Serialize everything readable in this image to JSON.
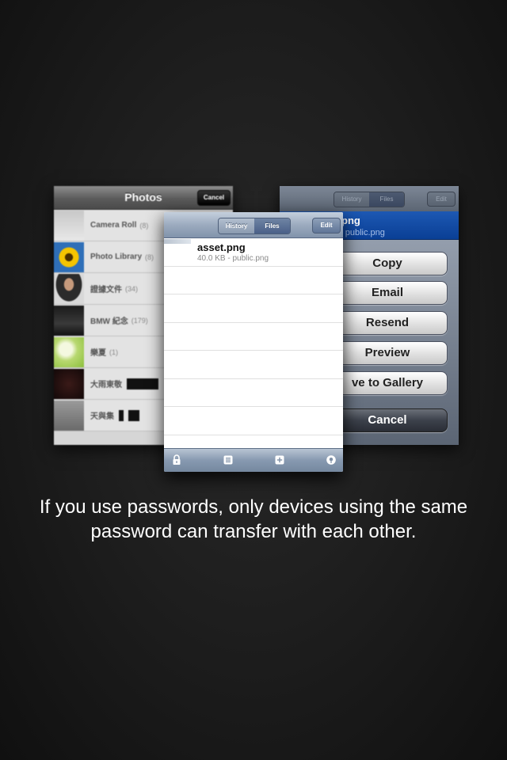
{
  "photos_screen": {
    "title": "Photos",
    "cancel_label": "Cancel",
    "albums": [
      {
        "name": "Camera Roll",
        "count": "(8)"
      },
      {
        "name": "Photo Library",
        "count": "(8)"
      },
      {
        "name": "證據文件",
        "count": "(34)"
      },
      {
        "name": "BMW 紀念",
        "count": "(179)"
      },
      {
        "name": "樂夏",
        "count": "(1)"
      },
      {
        "name": "大雨東敬",
        "count": ""
      },
      {
        "name": "天與集",
        "count": ""
      }
    ]
  },
  "files_screen": {
    "tab_history": "History",
    "tab_files": "Files",
    "edit_label": "Edit",
    "files": [
      {
        "name": "asset.png",
        "meta": "40.0 KB - public.png"
      }
    ],
    "empty_rows": 6,
    "toolbar_icons": [
      "lock-icon",
      "list-icon",
      "add-icon",
      "location-icon"
    ]
  },
  "action_screen": {
    "tab_history": "History",
    "tab_files": "Files",
    "edit_label": "Edit",
    "selected_name": "png",
    "selected_meta": "- public.png",
    "buttons": [
      "Copy",
      "Email",
      "Resend",
      "Preview",
      "ve to Gallery"
    ],
    "cancel_label": "Cancel"
  },
  "caption": {
    "line1": "If you use passwords, only devices using the same",
    "line2": "password can transfer with each other."
  }
}
